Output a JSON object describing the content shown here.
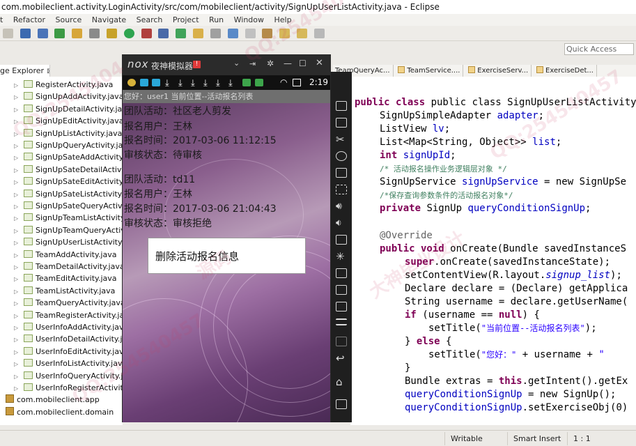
{
  "window": {
    "title": "com.mobileclient.activity.LoginActivity/src/com/mobileclient/activity/SignUpUserListActivity.java - Eclipse"
  },
  "menu": [
    "t",
    "Refactor",
    "Source",
    "Navigate",
    "Search",
    "Project",
    "Run",
    "Window",
    "Help"
  ],
  "quick_access": {
    "placeholder": "Quick Access"
  },
  "package_explorer": {
    "tab_label": "ge Explorer",
    "close": "⊠",
    "files": [
      "RegisterActivity.java",
      "SignUpAddActivity.java",
      "SignUpDetailActivity.java",
      "SignUpEditActivity.java",
      "SignUpListActivity.java",
      "SignUpQueryActivity.java",
      "SignUpSateAddActivity.jav",
      "SignUpSateDetailActivity.j",
      "SignUpSateEditActivity.jav",
      "SignUpSateListActivity.jav",
      "SignUpSateQueryActivity.j",
      "SignUpTeamListActivity.ja",
      "SignUpTeamQueryActivity",
      "SignUpUserListActivity.jav",
      "TeamAddActivity.java",
      "TeamDetailActivity.java",
      "TeamEditActivity.java",
      "TeamListActivity.java",
      "TeamQueryActivity.java",
      "TeamRegisterActivity.java",
      "UserInfoAddActivity.java",
      "UserInfoDetailActivity.java",
      "UserInfoEditActivity.java",
      "UserInfoListActivity.java",
      "UserInfoQueryActivity.jav",
      "UserInfoRegisterActivity.j"
    ],
    "packages": [
      "com.mobileclient.app",
      "com.mobileclient.domain"
    ]
  },
  "editor_tabs": [
    "TeamQueryAc...",
    "TeamService....",
    "ExerciseServ...",
    "ExerciseDet..."
  ],
  "editor": {
    "code": {
      "l0": "public class SignUpUserListActivity extends Ac",
      "l1_type": "SignUpSimpleAdapter ",
      "l1_field": "adapter",
      "l2_type": "ListView ",
      "l2_field": "lv",
      "l3_type": "List<Map<String, Object>> ",
      "l3_field": "list",
      "l4_kw": "int ",
      "l4_field": "signUpId",
      "l5": "/* 活动报名操作业务逻辑层对象 */",
      "l6_type": "SignUpService ",
      "l6_field": "signUpService",
      "l6_rest": " = new SignUpSe",
      "l7": "/*保存查询参数条件的活动报名对象*/",
      "l8_kw": "private ",
      "l8_type": "SignUp ",
      "l8_field": "queryConditionSignUp",
      "l9": "@Override",
      "l10_kw": "public void ",
      "l10_rest": "onCreate(Bundle savedInstanceS",
      "l11_kw": "super",
      "l11_rest": ".onCreate(savedInstanceState);",
      "l12_pre": "setContentView(R.layout.",
      "l12_field": "signup_list",
      "l12_post": ");",
      "l13": "Declare declare = (Declare) getApplica",
      "l14": "String username = declare.getUserName(",
      "l15_kw": "if ",
      "l15_mid": "(username == ",
      "l15_kw2": "null",
      "l15_post": ") {",
      "l16_pre": "setTitle(",
      "l16_str": "\"当前位置--活动报名列表\"",
      "l16_post": ");",
      "l17_pre": "} ",
      "l17_kw": "else",
      "l17_post": " {",
      "l18_pre": "setTitle(",
      "l18_str": "\"您好：\"",
      "l18_mid": " + username + ",
      "l18_str2": "\"   ",
      "l19": "}",
      "l20_pre": "Bundle extras = ",
      "l20_kw": "this",
      "l20_post": ".getIntent().getEx",
      "l21_field": "queryConditionSignUp",
      "l21_post": " = new SignUp();",
      "l22_field": "queryConditionSignUp",
      "l22_post": ".setExerciseObj(0)"
    }
  },
  "status": {
    "writable": "Writable",
    "insert": "Smart Insert",
    "pos": "1 : 1"
  },
  "emulator": {
    "logo": "nox",
    "title": "夜神模拟器",
    "badge": "!",
    "time": "2:19",
    "app_title": "您好：user1   当前位置--活动报名列表",
    "records": [
      {
        "activity": "团队活动：社区老人剪发",
        "user": "报名用户：王林",
        "time": "报名时间：2017-03-06 11:12:15",
        "status": "审核状态：待审核"
      },
      {
        "activity": "团队活动：td11",
        "user": "报名用户：王林",
        "time": "报名时间：2017-03-06 21:04:43",
        "status": "审核状态：审核拒绝"
      }
    ],
    "dialog": "删除活动报名信息"
  },
  "watermarks": [
    "QQ:2545404",
    "大神毕业设计",
    "QQ:254540457",
    "源码"
  ]
}
